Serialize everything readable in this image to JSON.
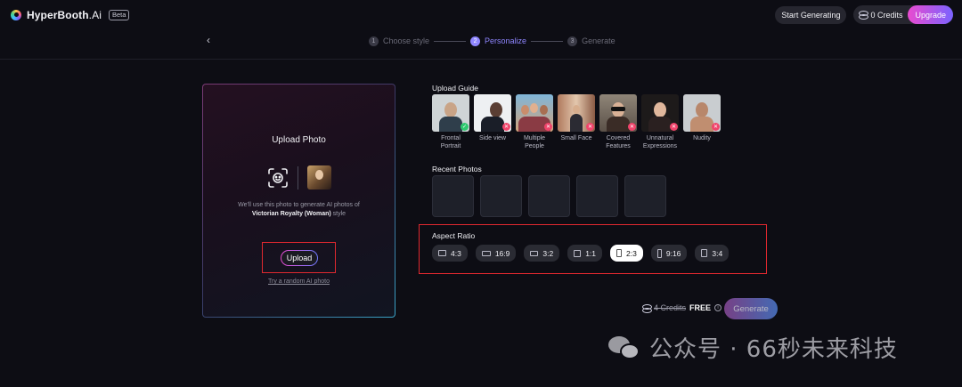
{
  "header": {
    "brand_main": "HyperBooth",
    "brand_suffix": ".Ai",
    "beta_badge": "Beta",
    "start_generating": "Start Generating",
    "credits": "0 Credits",
    "upgrade": "Upgrade"
  },
  "stepper": {
    "steps": [
      {
        "num": "1",
        "label": "Choose style",
        "active": false
      },
      {
        "num": "2",
        "label": "Personalize",
        "active": true
      },
      {
        "num": "3",
        "label": "Generate",
        "active": false
      }
    ]
  },
  "upload": {
    "title": "Upload Photo",
    "desc_line1": "We'll use this photo to generate AI photos of",
    "style_name": "Victorian Royalty (Woman)",
    "desc_suffix": " style",
    "button": "Upload",
    "random_link": "Try a random AI photo"
  },
  "guide": {
    "label": "Upload Guide",
    "items": [
      {
        "line1": "Frontal",
        "line2": "Portrait",
        "ok": true,
        "badge": "✓"
      },
      {
        "line1": "Side view",
        "line2": "",
        "ok": false,
        "badge": "✕"
      },
      {
        "line1": "Multiple",
        "line2": "People",
        "ok": false,
        "badge": "✕"
      },
      {
        "line1": "Small Face",
        "line2": "",
        "ok": false,
        "badge": "✕"
      },
      {
        "line1": "Covered",
        "line2": "Features",
        "ok": false,
        "badge": "✕"
      },
      {
        "line1": "Unnatural",
        "line2": "Expressions",
        "ok": false,
        "badge": "✕"
      },
      {
        "line1": "Nudity",
        "line2": "",
        "ok": false,
        "badge": "✕"
      }
    ]
  },
  "recent": {
    "label": "Recent Photos"
  },
  "aspect": {
    "label": "Aspect Ratio",
    "options": [
      {
        "label": "4:3",
        "selected": false
      },
      {
        "label": "16:9",
        "selected": false
      },
      {
        "label": "3:2",
        "selected": false
      },
      {
        "label": "1:1",
        "selected": false
      },
      {
        "label": "2:3",
        "selected": true
      },
      {
        "label": "9:16",
        "selected": false
      },
      {
        "label": "3:4",
        "selected": false
      }
    ]
  },
  "generate": {
    "old_cost": "4 Credits",
    "free": "FREE",
    "info": "i",
    "button": "Generate"
  },
  "watermark": {
    "text": "公众号 · 66秒未来科技"
  },
  "colors": {
    "accent": "#8f86ff",
    "upgrade_start": "#e94bd0",
    "upgrade_end": "#7a63ff",
    "highlight_frame": "#e0282f",
    "ok_badge": "#2ec96f",
    "no_badge": "#f0446b"
  }
}
